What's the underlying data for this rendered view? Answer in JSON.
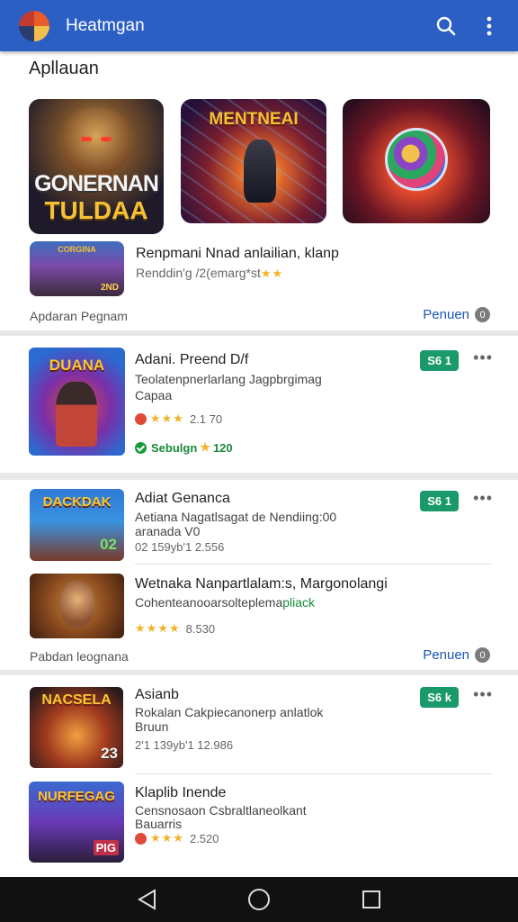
{
  "app_bar": {
    "title": "Heatmgan",
    "icons": [
      "app-logo",
      "search-icon",
      "more-vert-icon"
    ]
  },
  "featured": {
    "section_title": "Apllauan",
    "tile_a_line1": "GONERNAN",
    "tile_a_line2": "TULDAA",
    "tile_b_title": "MENTNEAI",
    "mini_label": "CORGINA",
    "mini_badge": "2ND",
    "title": "Renpmani Nnad anlailian, klanp",
    "subtitle": "Renddin'g /2(emarg*st",
    "subtitle_stars": "★★",
    "footer_left": "Apdaran Pegnam",
    "footer_right": "Penuen",
    "footer_count": "0"
  },
  "list1": {
    "thumb_title": "DUANA",
    "title": "Adani. Preend D/f",
    "desc_line1": "Teolatenpnerlarlang Jagpbrgimag",
    "desc_line2": "Capaa",
    "rating_stars": "★★★",
    "rating_text": "2.1 70",
    "badge": "S6 1",
    "menu": "•••",
    "install_label": "Sebulgn",
    "install_star": "★",
    "install_count": "120"
  },
  "list2": {
    "item1": {
      "thumb_title": "DACKDAK",
      "thumb_badge": "02",
      "title": "Adiat Genanca",
      "desc_line1": "Aetiana Nagatlsagat de Nendiing:00",
      "desc_line2": "aranada V0",
      "meta": "02 159yb'1 2.556",
      "badge": "S6 1",
      "menu": "•••"
    },
    "item2": {
      "title": "Wetnaka Nanpartlalam:s, Margonolangi",
      "desc_plain": "Cohenteanooarsolteplema",
      "desc_green": "pliack",
      "rating_stars": "★★★★",
      "rating_text": "8.530"
    },
    "footer_left": "Pabdan leognana",
    "footer_right": "Penuen",
    "footer_count": "0"
  },
  "list3": {
    "item1": {
      "thumb_title": "NACSELA",
      "thumb_badge": "23",
      "title": "Asianb",
      "desc_line1": "Rokalan Cakpiecanonerp anlatlok",
      "desc_line2": "Bruun",
      "meta": "2'1 139yb'1 12.986",
      "badge": "S6 k",
      "menu": "•••"
    },
    "item2": {
      "thumb_title": "NURFEGAG",
      "thumb_badge": "PIG",
      "title": "Klaplib Inende",
      "desc_line1": "Censnosaon Csbraltlaneolkant",
      "desc_line2": "Bauarris",
      "rating_stars": "★★★",
      "rating_text": "2.520"
    }
  },
  "nav": {
    "icons": [
      "back-icon",
      "home-icon",
      "recents-icon"
    ]
  },
  "colors": {
    "app_bar": "#2b5fc4",
    "link": "#1a56b8",
    "badge": "#1a9a6a",
    "star": "#f0b428"
  }
}
